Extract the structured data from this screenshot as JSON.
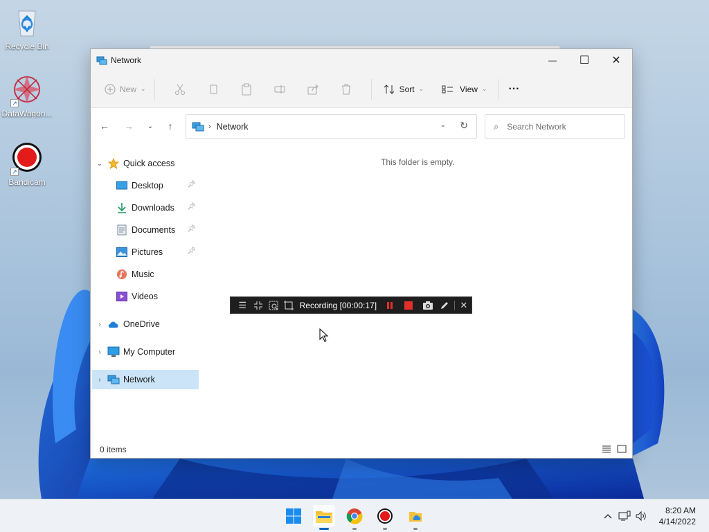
{
  "desktop": {
    "icons": [
      {
        "label": "Recycle Bin"
      },
      {
        "label": "DataWagon..."
      },
      {
        "label": "Bandicam"
      }
    ]
  },
  "window": {
    "title": "Network",
    "controls": {
      "minimize": "—",
      "maximize": "☐",
      "close": "✕"
    }
  },
  "commandbar": {
    "new_label": "New",
    "sort_label": "Sort",
    "view_label": "View",
    "more_label": "···"
  },
  "address": {
    "crumb": "Network",
    "search_placeholder": "Search Network"
  },
  "navpane": {
    "quick_access": "Quick access",
    "items": [
      {
        "label": "Desktop"
      },
      {
        "label": "Downloads"
      },
      {
        "label": "Documents"
      },
      {
        "label": "Pictures"
      },
      {
        "label": "Music"
      },
      {
        "label": "Videos"
      }
    ],
    "onedrive": "OneDrive",
    "my_computer": "My Computer",
    "network": "Network"
  },
  "content": {
    "empty_message": "This folder is empty."
  },
  "statusbar": {
    "item_count": "0 items"
  },
  "recorder": {
    "status": "Recording [00:00:17]",
    "colors": {
      "pause": "#e0302a",
      "stop": "#e0302a"
    }
  },
  "taskbar": {
    "time": "8:20 AM",
    "date": "4/14/2022"
  },
  "colors": {
    "selection": "#cce4f7",
    "accent": "#0067c0"
  }
}
